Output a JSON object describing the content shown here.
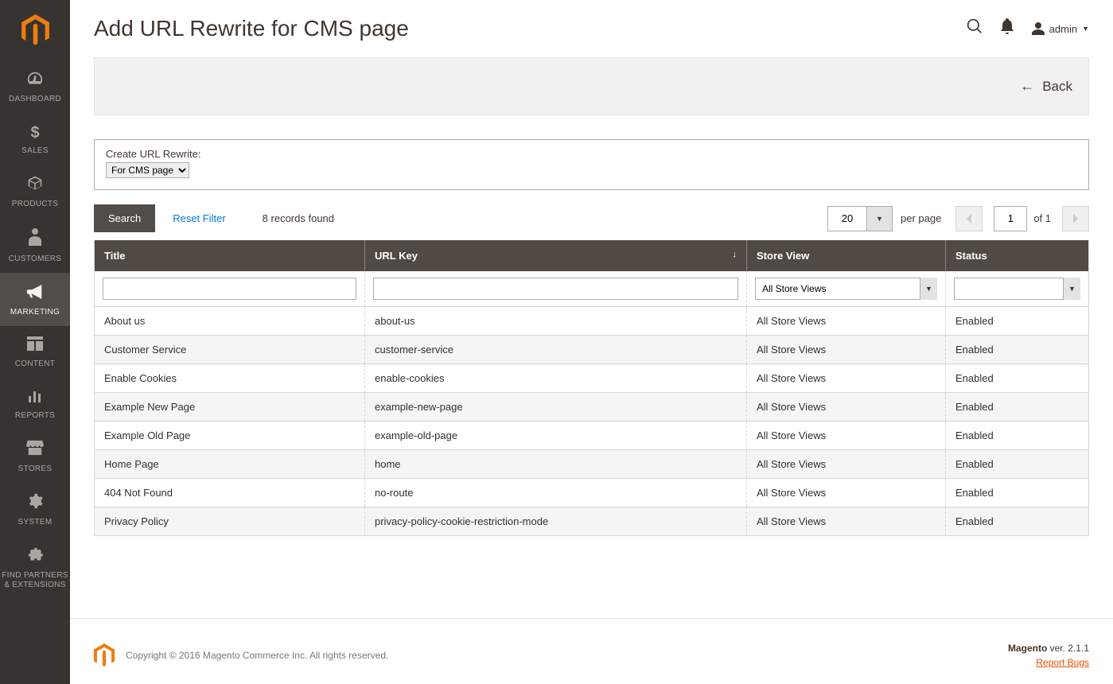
{
  "sidebar": {
    "items": [
      {
        "label": "DASHBOARD"
      },
      {
        "label": "SALES"
      },
      {
        "label": "PRODUCTS"
      },
      {
        "label": "CUSTOMERS"
      },
      {
        "label": "MARKETING"
      },
      {
        "label": "CONTENT"
      },
      {
        "label": "REPORTS"
      },
      {
        "label": "STORES"
      },
      {
        "label": "SYSTEM"
      },
      {
        "label": "FIND PARTNERS\n& EXTENSIONS"
      }
    ]
  },
  "header": {
    "title": "Add URL Rewrite for CMS page",
    "admin_label": "admin"
  },
  "actions": {
    "back_label": "Back"
  },
  "create_rewrite": {
    "label": "Create URL Rewrite:",
    "selected": "For CMS page"
  },
  "toolbar": {
    "search_label": "Search",
    "reset_label": "Reset Filter",
    "records_found": "8 records found",
    "per_page_value": "20",
    "per_page_label": "per page",
    "page_value": "1",
    "page_of": "of 1"
  },
  "grid": {
    "columns": {
      "title": "Title",
      "url_key": "URL Key",
      "store_view": "Store View",
      "status": "Status"
    },
    "filters": {
      "store_view_selected": "All Store Views"
    },
    "rows": [
      {
        "title": "About us",
        "url_key": "about-us",
        "store": "All Store Views",
        "status": "Enabled"
      },
      {
        "title": "Customer Service",
        "url_key": "customer-service",
        "store": "All Store Views",
        "status": "Enabled"
      },
      {
        "title": "Enable Cookies",
        "url_key": "enable-cookies",
        "store": "All Store Views",
        "status": "Enabled"
      },
      {
        "title": "Example New Page",
        "url_key": "example-new-page",
        "store": "All Store Views",
        "status": "Enabled"
      },
      {
        "title": "Example Old Page",
        "url_key": "example-old-page",
        "store": "All Store Views",
        "status": "Enabled"
      },
      {
        "title": "Home Page",
        "url_key": "home",
        "store": "All Store Views",
        "status": "Enabled"
      },
      {
        "title": "404 Not Found",
        "url_key": "no-route",
        "store": "All Store Views",
        "status": "Enabled"
      },
      {
        "title": "Privacy Policy",
        "url_key": "privacy-policy-cookie-restriction-mode",
        "store": "All Store Views",
        "status": "Enabled"
      }
    ]
  },
  "footer": {
    "copyright": "Copyright © 2016 Magento Commerce Inc. All rights reserved.",
    "version_prefix": "Magento",
    "version": "ver. 2.1.1",
    "report_bugs": "Report Bugs"
  }
}
